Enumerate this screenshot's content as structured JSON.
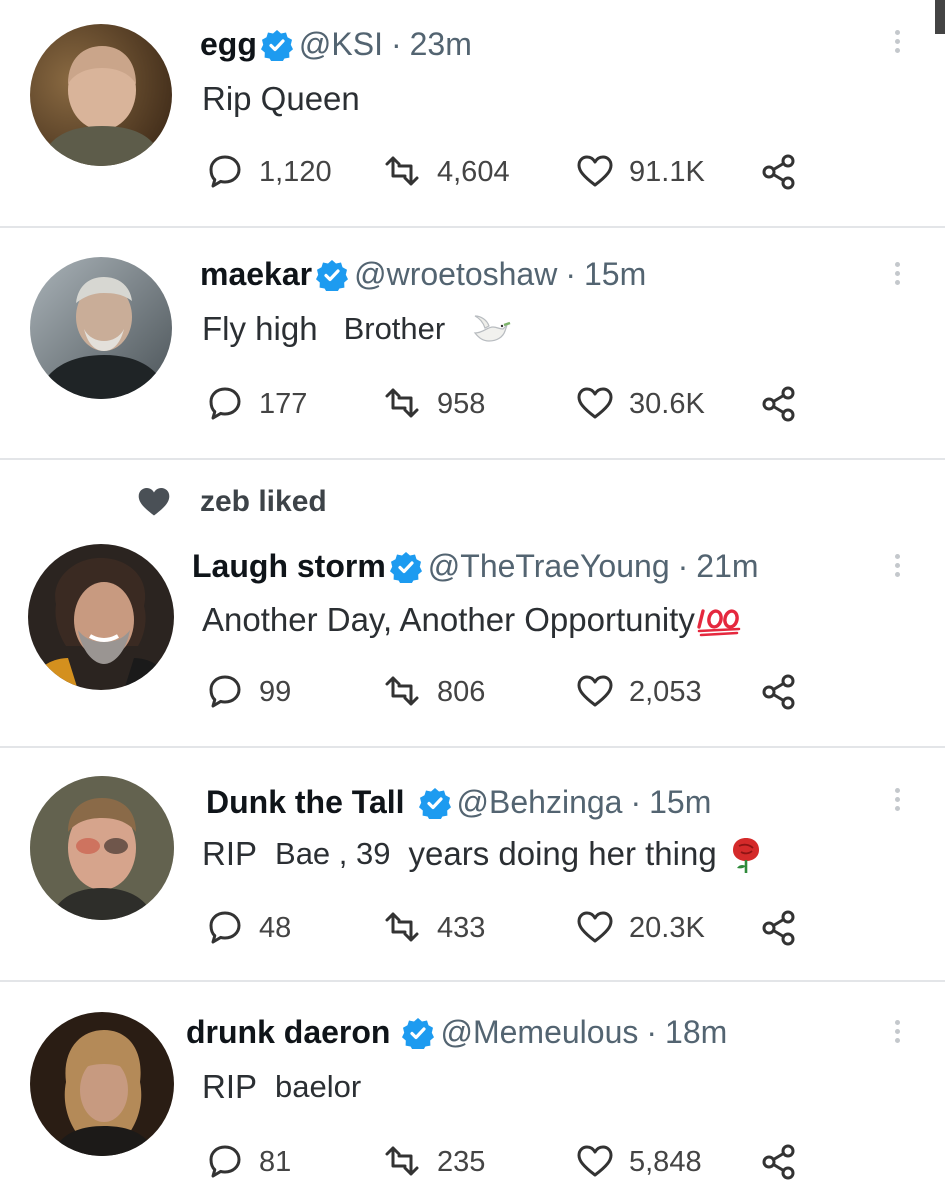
{
  "tweets": [
    {
      "name": "egg",
      "handle": "@KSI",
      "time": "23m",
      "text": "Rip Queen",
      "text_extra": "",
      "emoji": "",
      "replies": "1,120",
      "retweets": "4,604",
      "likes": "91.1K",
      "liked_by": ""
    },
    {
      "name": "maekar",
      "handle": "@wroetoshaw",
      "time": "15m",
      "text": "Fly high",
      "text_extra": "Brother",
      "emoji": "dove-emoji",
      "replies": "177",
      "retweets": "958",
      "likes": "30.6K",
      "liked_by": ""
    },
    {
      "name": "Laugh storm",
      "handle": "@TheTraeYoung",
      "time": "21m",
      "text": "Another Day, Another Opportunity",
      "text_extra": "",
      "emoji": "hundred-points-emoji",
      "replies": "99",
      "retweets": "806",
      "likes": "2,053",
      "liked_by": "zeb liked"
    },
    {
      "name": "Dunk the Tall",
      "handle": "@Behzinga",
      "time": "15m",
      "text": "RIP",
      "text_extra": "Bae , 39",
      "text_rest": "years doing her thing",
      "emoji": "rose-emoji",
      "replies": "48",
      "retweets": "433",
      "likes": "20.3K",
      "liked_by": ""
    },
    {
      "name": "drunk daeron",
      "handle": "@Memeulous",
      "time": "18m",
      "text": "RIP",
      "text_extra": "baelor",
      "emoji": "",
      "replies": "81",
      "retweets": "235",
      "likes": "5,848",
      "liked_by": ""
    }
  ],
  "separator": "·",
  "colors": {
    "verified": "#1d9bf0",
    "text": "#0f1419",
    "muted": "#536471",
    "divider": "#e3e5e8"
  }
}
